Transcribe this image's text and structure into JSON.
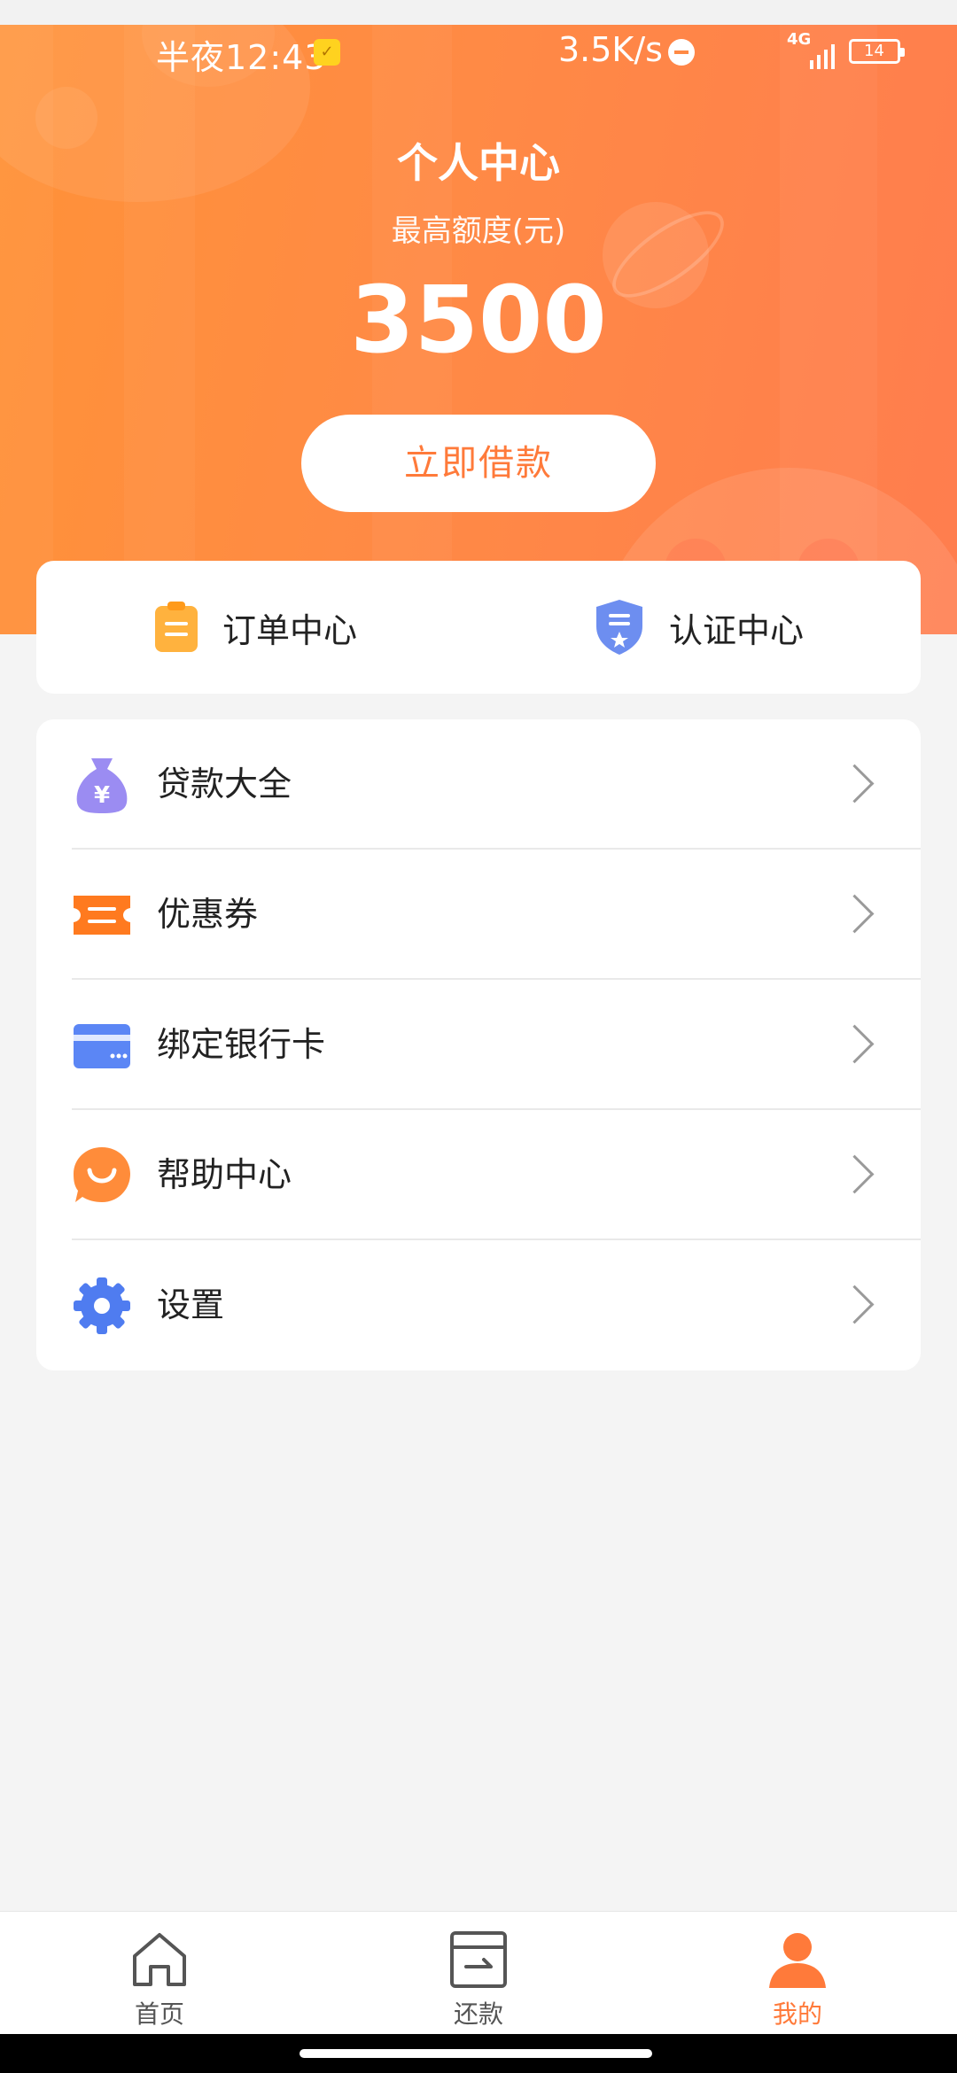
{
  "status_bar": {
    "time": "半夜12:43",
    "network_speed": "3.5K/s",
    "network_type": "4G",
    "battery": "14"
  },
  "header": {
    "title": "个人中心",
    "limit_label": "最高额度(元)",
    "limit_value": "3500",
    "borrow_button": "立即借款"
  },
  "quick_actions": [
    {
      "label": "订单中心",
      "icon": "clipboard-icon",
      "color": "#ffb23e"
    },
    {
      "label": "认证中心",
      "icon": "shield-star-icon",
      "color": "#6d8ef0"
    }
  ],
  "menu": [
    {
      "label": "贷款大全",
      "icon": "money-bag-icon",
      "color": "#9b8cf2"
    },
    {
      "label": "优惠券",
      "icon": "coupon-icon",
      "color": "#ff7a1f"
    },
    {
      "label": "绑定银行卡",
      "icon": "bank-card-icon",
      "color": "#5b86f5"
    },
    {
      "label": "帮助中心",
      "icon": "help-chat-icon",
      "color": "#ff8c3a"
    },
    {
      "label": "设置",
      "icon": "gear-icon",
      "color": "#4f7cf0"
    }
  ],
  "tabs": [
    {
      "label": "首页",
      "icon": "home-icon",
      "active": false
    },
    {
      "label": "还款",
      "icon": "repay-icon",
      "active": false
    },
    {
      "label": "我的",
      "icon": "user-icon",
      "active": true
    }
  ],
  "colors": {
    "accent": "#ff7a3a",
    "header_gradient_start": "#ff9238",
    "header_gradient_end": "#ff7d4e",
    "background": "#f4f4f4"
  }
}
